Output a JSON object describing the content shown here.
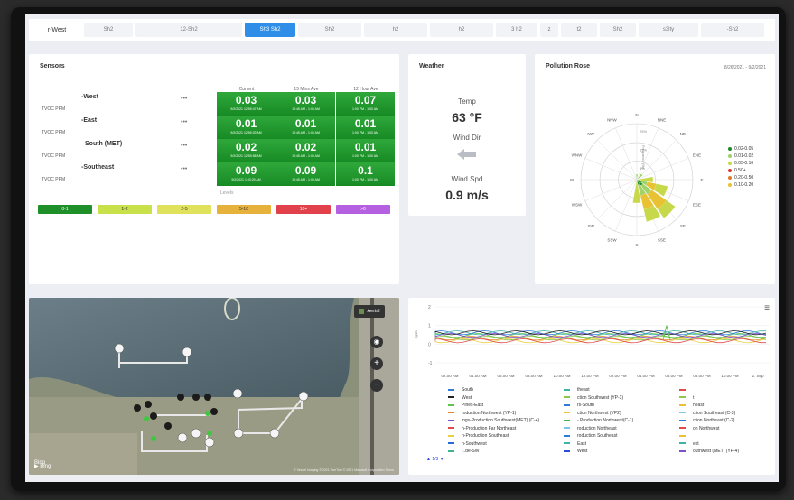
{
  "tabs": [
    {
      "label": "r-West",
      "w": 54,
      "active": false,
      "first": true
    },
    {
      "label": "Sh2",
      "w": 54,
      "active": false
    },
    {
      "label": "12-Sh2",
      "w": 118,
      "active": false
    },
    {
      "label": "Sh3 Sh2",
      "w": 56,
      "active": true
    },
    {
      "label": "Sh2",
      "w": 70,
      "active": false
    },
    {
      "label": "h2",
      "w": 70,
      "active": false
    },
    {
      "label": "h2",
      "w": 70,
      "active": false
    },
    {
      "label": "3 h2",
      "w": 46,
      "active": false
    },
    {
      "label": "z",
      "w": 20,
      "active": false
    },
    {
      "label": "t2",
      "w": 40,
      "active": false
    },
    {
      "label": "Sh2",
      "w": 40,
      "active": false
    },
    {
      "label": "s3lty",
      "w": 66,
      "active": false
    },
    {
      "label": "-Sh2",
      "w": 70,
      "active": false
    }
  ],
  "sensors": {
    "title": "Sensors",
    "columns": [
      "Current",
      "15 Mins Ave",
      "12 Hour Ave"
    ],
    "more_icon": "•••",
    "rows": [
      {
        "name": "-West",
        "unit": "TVOC PPM",
        "values": [
          "0.03",
          "0.03",
          "0.07"
        ],
        "times": [
          "9/2/2021 12:59:47 AM",
          "12:45 AM - 1:00 AM",
          "1:00 PM - 1:00 AM"
        ]
      },
      {
        "name": "-East",
        "unit": "TVOC PPM",
        "values": [
          "0.01",
          "0.01",
          "0.01"
        ],
        "times": [
          "9/2/2021 12:59:33 AM",
          "12:45 AM - 1:00 AM",
          "1:00 PM - 1:00 AM"
        ]
      },
      {
        "name": "South (MET)",
        "unit": "TVOC PPM",
        "values": [
          "0.02",
          "0.02",
          "0.01"
        ],
        "times": [
          "9/2/2021 12:59:58 AM",
          "12:45 AM - 1:00 AM",
          "1:00 PM - 1:00 AM"
        ]
      },
      {
        "name": "-Southeast",
        "unit": "TVOC PPM",
        "values": [
          "0.09",
          "0.09",
          "0.1"
        ],
        "times": [
          "9/2/2021 1:03:29 AM",
          "12:45 AM - 1:00 AM",
          "1:00 PM - 1:00 AM"
        ]
      }
    ],
    "levels_label": "Levels",
    "legend": [
      {
        "label": "0-1",
        "color": "#1f8f2a",
        "text": "#ffffff"
      },
      {
        "label": "1-2",
        "color": "#c8e04a",
        "text": "#333333"
      },
      {
        "label": "2-5",
        "color": "#dfe25a",
        "text": "#333333"
      },
      {
        "label": "5-10",
        "color": "#e6b23c",
        "text": "#333333"
      },
      {
        "label": "10+",
        "color": "#e0414a",
        "text": "#ffffff"
      },
      {
        "label": ">0",
        "color": "#b460e0",
        "text": "#ffffff"
      }
    ]
  },
  "weather": {
    "title": "Weather",
    "temp_label": "Temp",
    "temp_value": "63 °F",
    "wind_dir_label": "Wind Dir",
    "wind_spd_label": "Wind Spd",
    "wind_spd_value": "0.9 m/s"
  },
  "pollution_rose": {
    "title": "Pollution Rose",
    "date_range": "8/26/2021 - 9/2/2021",
    "directions": [
      "N",
      "NNE",
      "NE",
      "ENE",
      "E",
      "ESE",
      "SE",
      "SSE",
      "S",
      "SSW",
      "SW",
      "WSW",
      "W",
      "WNW",
      "NW",
      "NNW"
    ],
    "ring_labels": [
      "25%",
      "15%",
      "5%"
    ],
    "axis_label": "Frequency (%)",
    "legend": [
      {
        "label": "0.02-0.05",
        "color": "#1e8a26"
      },
      {
        "label": "0.01-0.02",
        "color": "#9fd26a"
      },
      {
        "label": "0.05-0.10",
        "color": "#c7d94a"
      },
      {
        "label": "0.50+",
        "color": "#d43a2a"
      },
      {
        "label": "0.20-0.50",
        "color": "#e07a2a"
      },
      {
        "label": "0.10-0.20",
        "color": "#e8c232"
      }
    ]
  },
  "map": {
    "mode_label": "Aerial",
    "brand": "Bing",
    "attribution": "© Vexcel Imaging © 2021 TomTom © 2021 Microsoft Corporation Terms"
  },
  "timeseries": {
    "menu_icon": "≡",
    "y_ticks": [
      "2",
      "1",
      "0",
      "-1"
    ],
    "ylabel": "ppm",
    "x_ticks": [
      "02:00 AM",
      "04:00 AM",
      "06:00 AM",
      "08:00 AM",
      "10:00 AM",
      "12:00 PM",
      "02:00 PM",
      "04:00 PM",
      "06:00 PM",
      "08:00 PM",
      "10:00 PM",
      "2. Sep"
    ],
    "legend_col1": [
      {
        "label": "South",
        "color": "#2f7bd8"
      },
      {
        "label": "West",
        "color": "#222222"
      },
      {
        "label": "Pines-East",
        "color": "#5fc24c"
      },
      {
        "label": "roduction Northwest (YP-1)",
        "color": "#e58a2a"
      },
      {
        "label": "ings-Production Southwest(MET) (C-4)",
        "color": "#7d4fc8"
      },
      {
        "label": "n-Production Far Northeast",
        "color": "#e04a4a"
      },
      {
        "label": "n-Production Southeast",
        "color": "#e8d040"
      },
      {
        "label": "n-Southwest",
        "color": "#2a6ad8"
      },
      {
        "label": "...de-SW",
        "color": "#3fb38e"
      }
    ],
    "legend_col2": [
      {
        "label": "theast",
        "color": "#3fb3a8"
      },
      {
        "label": "ction Southwest (YP-3)",
        "color": "#8bc94a"
      },
      {
        "label": "rs-South",
        "color": "#2f7bd8"
      },
      {
        "label": "ction Northwest (YP2)",
        "color": "#e8c232"
      },
      {
        "label": "- Production Northwest(C-1)",
        "color": "#47b04a"
      },
      {
        "label": "roduction Northeast",
        "color": "#7cc7e8"
      },
      {
        "label": "roduction Southeast",
        "color": "#2f7bd8"
      },
      {
        "label": "East",
        "color": "#3fb3a8"
      },
      {
        "label": "West",
        "color": "#2a4ad8"
      }
    ],
    "legend_col3": [
      {
        "label": "",
        "color": "#e04a4a"
      },
      {
        "label": "t",
        "color": "#8bc94a"
      },
      {
        "label": "heast",
        "color": "#e8c232"
      },
      {
        "label": "ction Southeast (C-3)",
        "color": "#7cc7e8"
      },
      {
        "label": "ction Northeast (C-2)",
        "color": "#2f7bd8"
      },
      {
        "label": "on Northwest",
        "color": "#e04a4a"
      },
      {
        "label": "",
        "color": "#e8c232"
      },
      {
        "label": "ext",
        "color": "#3fb3a8"
      },
      {
        "label": "outhwest (MET) (YP-4)",
        "color": "#7d4fc8"
      }
    ],
    "pager": "1/3"
  }
}
